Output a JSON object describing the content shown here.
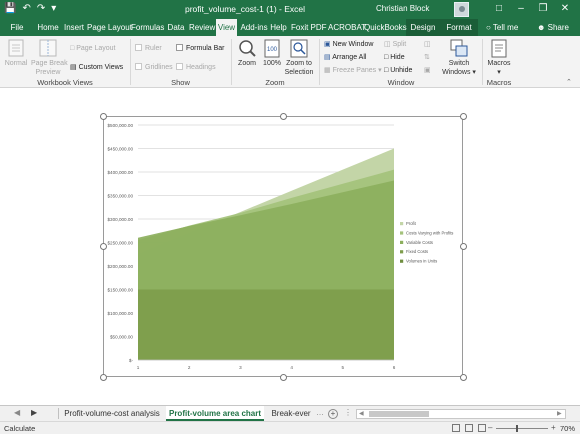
{
  "window": {
    "title": "profit_volume_cost-1 (1)  -  Excel",
    "user": "Christian Block"
  },
  "tabs": [
    {
      "label": "File"
    },
    {
      "label": "Home"
    },
    {
      "label": "Insert"
    },
    {
      "label": "Page Layout"
    },
    {
      "label": "Formulas"
    },
    {
      "label": "Data"
    },
    {
      "label": "Review"
    },
    {
      "label": "View"
    },
    {
      "label": "Add-ins"
    },
    {
      "label": "Help"
    },
    {
      "label": "Foxit PDF"
    },
    {
      "label": "ACROBAT"
    },
    {
      "label": "QuickBooks"
    },
    {
      "label": "Design"
    },
    {
      "label": "Format"
    }
  ],
  "tell_me": "Tell me",
  "share": "Share",
  "ribbon": {
    "workbook_views": {
      "label": "Workbook Views",
      "normal": "Normal",
      "page_break_preview_1": "Page Break",
      "page_break_preview_2": "Preview",
      "page_layout": "Page Layout",
      "custom_views": "Custom Views"
    },
    "show": {
      "label": "Show",
      "ruler": "Ruler",
      "formula_bar": "Formula Bar",
      "gridlines": "Gridlines",
      "headings": "Headings"
    },
    "zoom": {
      "label": "Zoom",
      "zoom": "Zoom",
      "hundred": "100%",
      "zoom_to_selection_1": "Zoom to",
      "zoom_to_selection_2": "Selection"
    },
    "window": {
      "label": "Window",
      "new_window": "New Window",
      "arrange_all": "Arrange All",
      "freeze_panes": "Freeze Panes",
      "split": "Split",
      "hide": "Hide",
      "unhide": "Unhide",
      "switch_windows_1": "Switch",
      "switch_windows_2": "Windows"
    },
    "macros": {
      "label": "Macros",
      "macros": "Macros"
    }
  },
  "chart_data": {
    "type": "area",
    "x": [
      1,
      2,
      3,
      4,
      5,
      6
    ],
    "y_tick_labels": [
      "$-",
      "$50,000.00",
      "$100,000.00",
      "$150,000.00",
      "$200,000.00",
      "$250,000.00",
      "$300,000.00",
      "$350,000.00",
      "$400,000.00",
      "$450,000.00",
      "$500,000.00"
    ],
    "ylim": [
      0,
      500000
    ],
    "xlim": [
      1,
      6
    ],
    "series": [
      {
        "name": "Profit",
        "values": [
          225000,
          270000,
          315000,
          360000,
          405000,
          450000
        ],
        "color": "#c3d5a7"
      },
      {
        "name": "Costs Varying with Profits",
        "values": [
          255000,
          286000,
          313000,
          345000,
          375000,
          405000
        ],
        "color": "#a4c27b"
      },
      {
        "name": "Variable Costs",
        "values": [
          260000,
          285000,
          308000,
          332000,
          357000,
          382000
        ],
        "color": "#8caf5d"
      },
      {
        "name": "Fixed Costs",
        "values": [
          150000,
          150000,
          150000,
          150000,
          150000,
          150000
        ],
        "color": "#7e9d4c"
      },
      {
        "name": "Volumes in Units",
        "values": [
          0,
          0,
          0,
          0,
          0,
          0
        ],
        "color": "#6f8e40"
      }
    ],
    "legend_position": "right",
    "grid": true
  },
  "sheet_tabs": [
    {
      "label": "Profit-volume-cost analysis",
      "active": false
    },
    {
      "label": "Profit-volume area chart",
      "active": true
    },
    {
      "label": "Break-ever",
      "active": false
    }
  ],
  "status": {
    "mode": "Calculate",
    "zoom": "70%"
  }
}
